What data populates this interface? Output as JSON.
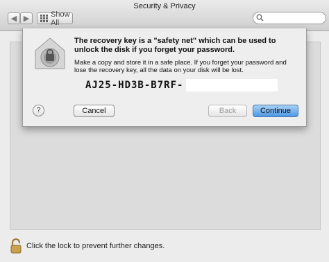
{
  "window": {
    "title": "Security & Privacy"
  },
  "toolbar": {
    "back_glyph": "◀",
    "forward_glyph": "▶",
    "show_all_label": "Show All"
  },
  "search": {
    "placeholder": "",
    "icon": "search-icon"
  },
  "sheet": {
    "headline": "The recovery key is a \"safety net\" which can be used to unlock the disk if you forget your password.",
    "body": "Make a copy and store it in a safe place. If you forget your password and lose the recovery key, all the data on your disk will be lost.",
    "recovery_key": "AJ25-HD3B-B7RF-",
    "help_label": "?",
    "cancel_label": "Cancel",
    "back_label": "Back",
    "continue_label": "Continue",
    "icon": "filevault-lock-icon"
  },
  "footer": {
    "lock_text": "Click the lock to prevent further changes.",
    "icon": "open-padlock-icon"
  }
}
